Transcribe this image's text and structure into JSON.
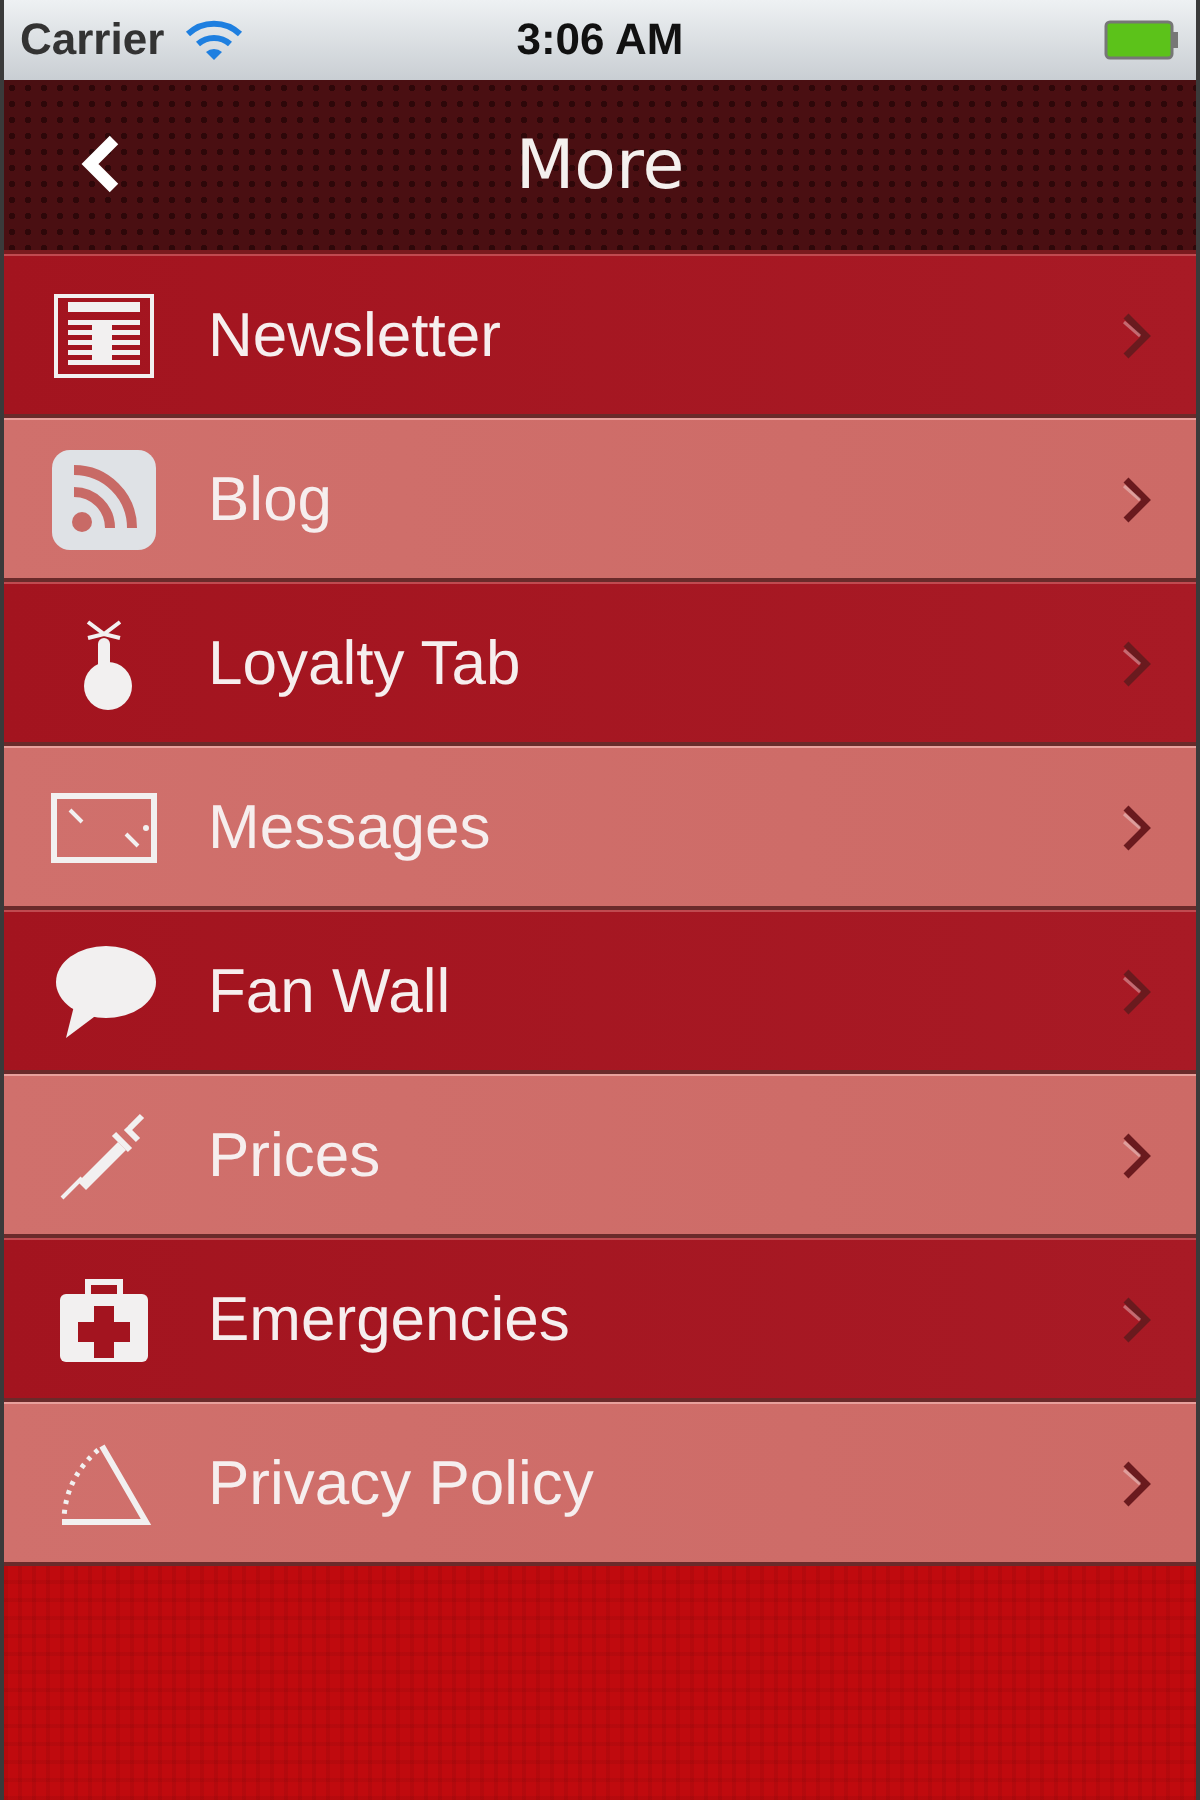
{
  "status_bar": {
    "carrier": "Carrier",
    "time": "3:06 AM"
  },
  "nav_bar": {
    "title": "More"
  },
  "items": [
    {
      "label": "Newsletter"
    },
    {
      "label": "Blog"
    },
    {
      "label": "Loyalty Tab"
    },
    {
      "label": "Messages"
    },
    {
      "label": "Fan Wall"
    },
    {
      "label": "Prices"
    },
    {
      "label": "Emergencies"
    },
    {
      "label": "Privacy Policy"
    }
  ]
}
